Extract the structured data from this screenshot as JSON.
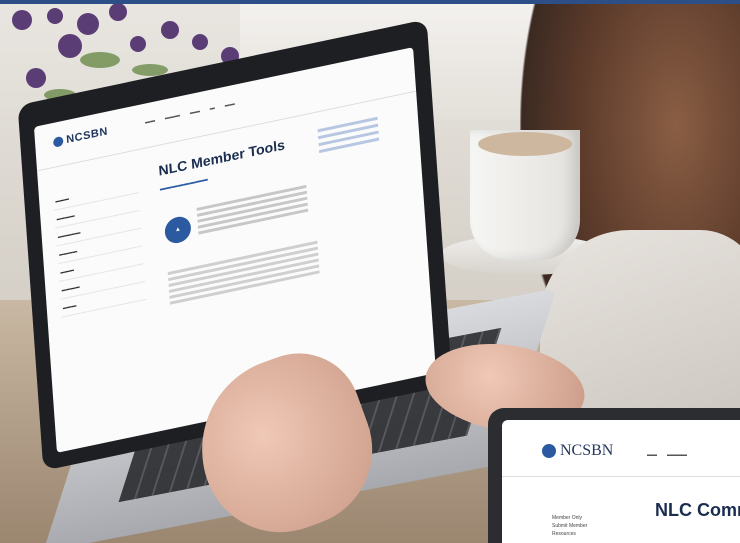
{
  "laptop_screen": {
    "logo": "NCSBN",
    "title": "NLC Member Tools"
  },
  "tablet_screen": {
    "logo": "NCSBN",
    "title": "NLC Comm",
    "sidebar_items": [
      "Member Only",
      "Submit Member",
      "Resources"
    ]
  }
}
